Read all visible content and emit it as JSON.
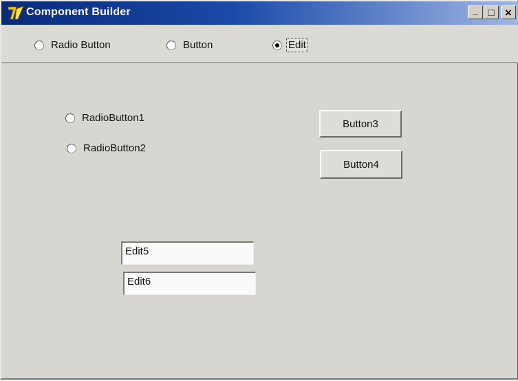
{
  "window": {
    "title": "Component Builder",
    "controls": {
      "minimize_glyph": "_",
      "maximize_glyph": "□",
      "close_glyph": "×"
    }
  },
  "toolbar": {
    "options": [
      {
        "label": "Radio Button",
        "checked": false
      },
      {
        "label": "Button",
        "checked": false
      },
      {
        "label": "Edit",
        "checked": true
      }
    ]
  },
  "form": {
    "radios": [
      {
        "label": "RadioButton1",
        "checked": false
      },
      {
        "label": "RadioButton2",
        "checked": false
      }
    ],
    "buttons": [
      "Button3",
      "Button4"
    ],
    "edits": [
      "Edit5",
      "Edit6"
    ]
  },
  "colors": {
    "title_gradient_start": "#0a2a7a",
    "title_gradient_end": "#9fb6e4",
    "window_face": "#d8d6d0"
  }
}
